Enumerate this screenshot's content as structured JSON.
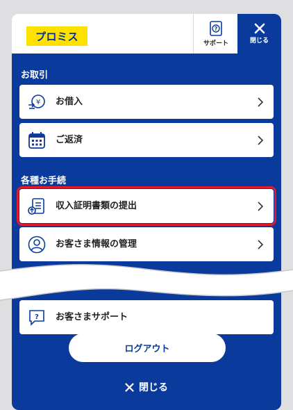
{
  "header": {
    "logo_text": "プロミス",
    "support_label": "サポート",
    "close_label": "閉じる"
  },
  "sections": [
    {
      "title": "お取引",
      "items": [
        {
          "label": "お借入",
          "icon": "yen-transfer-icon"
        },
        {
          "label": "ご返済",
          "icon": "calendar-icon"
        }
      ]
    },
    {
      "title": "各種お手続",
      "items": [
        {
          "label": "収入証明書類の提出",
          "icon": "document-upload-icon",
          "highlighted": true
        },
        {
          "label": "お客さま情報の管理",
          "icon": "user-profile-icon"
        },
        {
          "label": "お客さまサポート",
          "icon": "help-chat-icon"
        }
      ]
    }
  ],
  "footer": {
    "logout_label": "ログアウト",
    "close_label": "閉じる"
  },
  "colors": {
    "primary": "#0a3a9c",
    "logo_bg": "#ffe100",
    "highlight": "#e1192c",
    "background": "#dfdfe1"
  }
}
